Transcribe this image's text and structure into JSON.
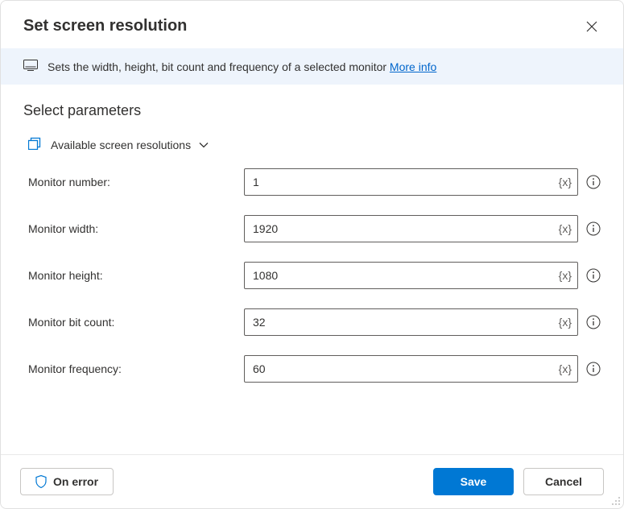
{
  "dialog": {
    "title": "Set screen resolution"
  },
  "banner": {
    "text": "Sets the width, height, bit count and frequency of a selected monitor ",
    "more_info": "More info"
  },
  "section": {
    "title": "Select parameters",
    "collapsible_label": "Available screen resolutions"
  },
  "fields": {
    "monitor_number": {
      "label": "Monitor number:",
      "value": "1"
    },
    "monitor_width": {
      "label": "Monitor width:",
      "value": "1920"
    },
    "monitor_height": {
      "label": "Monitor height:",
      "value": "1080"
    },
    "monitor_bit_count": {
      "label": "Monitor bit count:",
      "value": "32"
    },
    "monitor_frequency": {
      "label": "Monitor frequency:",
      "value": "60"
    }
  },
  "variable_badge": "{x}",
  "footer": {
    "on_error": "On error",
    "save": "Save",
    "cancel": "Cancel"
  }
}
